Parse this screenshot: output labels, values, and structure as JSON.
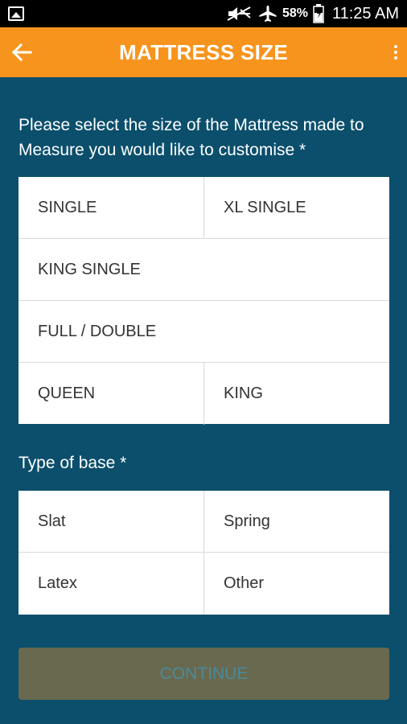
{
  "status_bar": {
    "battery": "58%",
    "time": "11:25 AM",
    "icons": [
      "gallery-icon",
      "mute-icon",
      "airplane-icon",
      "battery-icon"
    ]
  },
  "app_bar": {
    "title": "MATTRESS SIZE",
    "back_icon": "arrow-left-icon",
    "menu_icon": "more-vert-icon"
  },
  "size_section": {
    "prompt": "Please select the size of the Mattress made to Measure you would like to customise *",
    "options": [
      "SINGLE",
      "XL SINGLE",
      "KING SINGLE",
      "FULL / DOUBLE",
      "QUEEN",
      "KING"
    ]
  },
  "base_section": {
    "label": "Type of base *",
    "options": [
      "Slat",
      "Spring",
      "Latex",
      "Other"
    ]
  },
  "continue_button": {
    "label": "CONTINUE"
  },
  "colors": {
    "background": "#0b4f6c",
    "app_bar": "#f7941d",
    "button_disabled": "#68694e",
    "button_text": "#4c8a99"
  }
}
